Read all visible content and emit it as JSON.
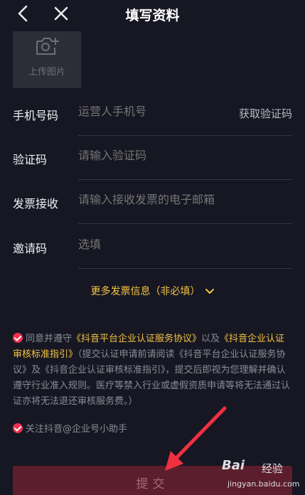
{
  "nav": {
    "title": "填写资料"
  },
  "upload": {
    "label": "上传图片"
  },
  "form": {
    "phone_label": "手机号码",
    "phone_placeholder": "运营人手机号",
    "get_code": "获取验证码",
    "code_label": "验证码",
    "code_placeholder": "请输入验证码",
    "invoice_label": "发票接收",
    "invoice_placeholder": "请输入接收发票的电子邮箱",
    "invite_label": "邀请码",
    "invite_placeholder": "选填"
  },
  "more_invoice": "更多发票信息（非必填）",
  "agreement": {
    "prefix": "同意并遵守",
    "link1": "《抖音平台企业认证服务协议》",
    "mid1": "以及",
    "link2": "《抖音企业认证审核标准指引》",
    "rest": "（提交认证申请前请阅读《抖音平台企业认证服务协议》及《抖音企业认证审核标准指引》，提交后即视为您理解并确认遵守行业准入规则。医疗等禁入行业或虚假资质申请等将无法通过认证亦将无法退还审核服务费。）"
  },
  "follow": {
    "label": "关注抖音@企业号小助手"
  },
  "submit": {
    "label": "提交"
  },
  "watermark": {
    "brand": "Bai",
    "site": "经验",
    "url": "jingyan.baidu.com"
  },
  "colors": {
    "accent": "#f5c443",
    "check": "#f0304e",
    "submit_bg": "#5c1e2c",
    "background": "#161722"
  }
}
